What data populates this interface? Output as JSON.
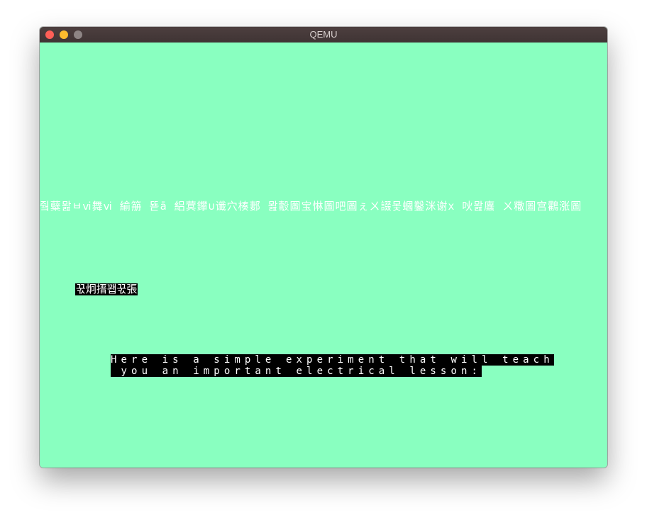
{
  "window": {
    "title": "QEMU",
    "controls": {
      "close_color": "#fe5f57",
      "minimize_color": "#febc2e",
      "zoom_color": "#8e8585"
    }
  },
  "screen": {
    "background_color": "#89ffc0",
    "garbled_line": "줰糵뫒ㅂⅵ舞ⅵ 緰笧 뚇ā 絽蓂鑻∪谶穴楱郪 뫒鷇圗宝惏圖吧圖ぇㄨ諁몿蟈鑿洣谢x 吙뫒蠯 ㄨ糤圖宫鸛涨圖",
    "garbled_label": "꾻炯搢꽵꾻張",
    "message_lines": [
      "Here is a simple experiment that will teach",
      " you an important electrical lesson:"
    ]
  }
}
